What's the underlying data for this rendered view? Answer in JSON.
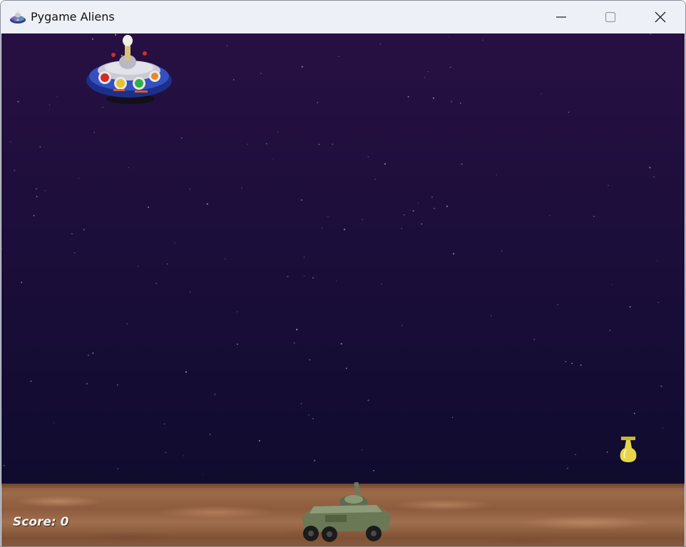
{
  "window": {
    "title": "Pygame Aliens",
    "app_icon": "ufo-icon",
    "controls": [
      "minimize-icon",
      "maximize-icon",
      "close-icon"
    ]
  },
  "game": {
    "score_text": "Score: 0",
    "colors": {
      "sky_top": "#271043",
      "sky_bottom": "#0d0b2a",
      "ground": "#8a5a3d",
      "score_text": "#f3f3f3"
    },
    "sprites": [
      "alien-ufo",
      "player-tank",
      "alien-bomb"
    ]
  }
}
